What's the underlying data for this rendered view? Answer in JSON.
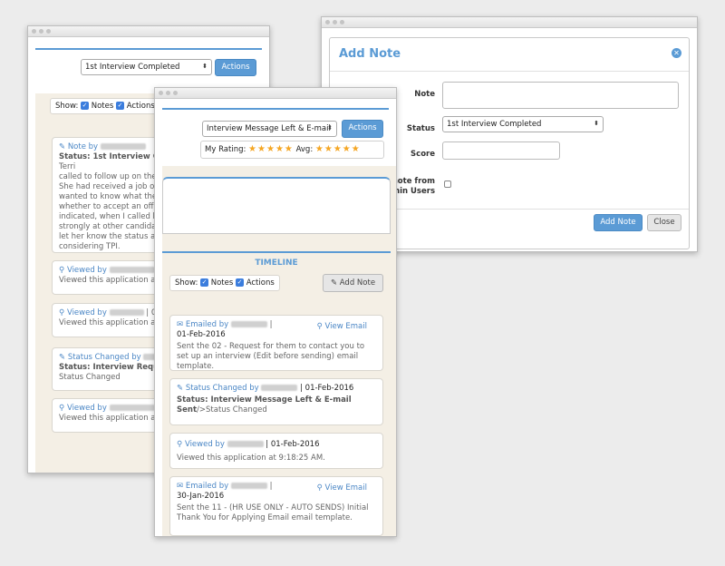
{
  "back_window": {
    "status_select": "1st Interview Completed",
    "actions_label": "Actions",
    "show_label": "Show:",
    "notes_label": "Notes",
    "actions_check_label": "Actions",
    "cards": [
      {
        "title": "Note by",
        "lines": [
          "Status: 1st Interview Compl",
          "Terri",
          "called to follow up on the sta",
          "She had received a job offer",
          "wanted to know what the sta",
          "whether to accept an offer e",
          "indicated, when I called him",
          "strongly at other candidates.",
          "let her know the status and t",
          "considering TPI."
        ]
      },
      {
        "title": "Viewed by",
        "lines": [
          "Viewed this application at 12"
        ]
      },
      {
        "title": "Viewed by",
        "lines": [
          "Viewed this application at 4:"
        ]
      },
      {
        "title": "Status Changed by",
        "lines": [
          "Status: Interview Requested",
          "Status Changed"
        ]
      },
      {
        "title": "Viewed by",
        "lines": [
          "Viewed this application at 1:"
        ]
      }
    ]
  },
  "mid_window": {
    "status_select": "Interview Message Left & E-mail",
    "actions_label": "Actions",
    "my_rating_label": "My Rating:",
    "avg_label": "Avg:",
    "stars": "★★★★★",
    "timeline_title": "TIMELINE",
    "show_label": "Show:",
    "notes_label": "Notes",
    "actions_check_label": "Actions",
    "add_note_label": "Add Note",
    "cards": [
      {
        "title": "Emailed by",
        "sep": "|",
        "date": "01-Feb-2016",
        "view_email": "View Email",
        "body": "Sent the 02 - Request for them to contact you to set up an interview (Edit before sending) email template."
      },
      {
        "title": "Status Changed by",
        "date": "| 01-Feb-2016",
        "body_bold": "Status: Interview Message Left & E-mail Sent",
        "body": "/>Status Changed"
      },
      {
        "title": "Viewed by",
        "date": "| 01-Feb-2016",
        "body": "Viewed this application at 9:18:25 AM."
      },
      {
        "title": "Emailed by",
        "sep": "|",
        "date": "30-Jan-2016",
        "view_email": "View Email",
        "body": "Sent the 11 - (HR USE ONLY - AUTO SENDS) Initial Thank You for Applying Email email template."
      }
    ]
  },
  "modal": {
    "title": "Add Note",
    "note_label": "Note",
    "status_label": "Status",
    "status_value": "1st Interview Completed",
    "score_label": "Score",
    "hide_label_1": "note from",
    "hide_label_2": "dmin Users",
    "add_note_label": "Add Note",
    "close_label": "Close"
  },
  "colors": {
    "accent": "#5b9bd5",
    "link": "#4a86c5",
    "star": "#f5a623"
  }
}
